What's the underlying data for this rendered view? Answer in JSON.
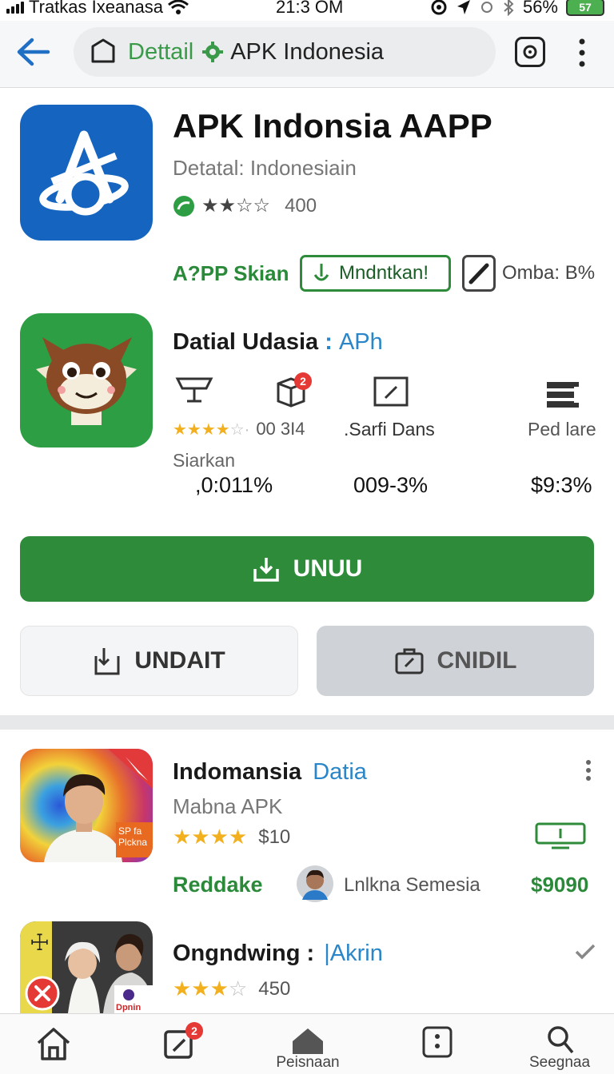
{
  "status_bar": {
    "carrier": "Tratkas Ixeanasa",
    "time": "21:3 OM",
    "battery_pct": "56%",
    "battery_label": "57"
  },
  "browser": {
    "site": "Dettail",
    "title": "APK Indonesia"
  },
  "app": {
    "name": "APK Indonsia AAPP",
    "subtitle": "Detatal: Indonesiain",
    "rating_count": "400",
    "stars": 2.5,
    "tag": "A?PP Skian",
    "outline_btn": "Mndntkan!",
    "omba": "Omba: B%"
  },
  "detail": {
    "title_a": "Datial Udasia",
    "sep": ":",
    "title_b": "APh",
    "stars": 4,
    "reviews": "00 3I4",
    "stat2_label": ".Sarfi Dans",
    "stat3_label": "Ped lare",
    "siarkan": "Siarkan",
    "val1": ",0:011%",
    "val2": "009-3%",
    "val3": "$9:3%",
    "badge": "2"
  },
  "buttons": {
    "primary": "UNUU",
    "secondary": "UNDAIT",
    "tertiary": "CNIDIL"
  },
  "list": [
    {
      "title": "Indomansia",
      "title_accent": "Datia",
      "subtitle": "Mabna APK",
      "stars": 4,
      "price": "$10",
      "left_label": "Reddake",
      "user": "Lnlkna Semesia",
      "right_price": "$9090",
      "thumb_text": "SP fa Plckna"
    },
    {
      "title": "Ongndwing",
      "sep": ":",
      "title_accent": "|Akrin",
      "stars": 3,
      "count": "450",
      "thumb_text": "Dpnin"
    }
  ],
  "nav": {
    "badge": "2",
    "item3": "Peisnaan",
    "item5": "Seegnaa"
  },
  "colors": {
    "primary_green": "#2d8b3a",
    "accent_blue": "#2a86c8",
    "app_icon_blue": "#1565c0",
    "app_icon_green": "#2e9e44"
  }
}
